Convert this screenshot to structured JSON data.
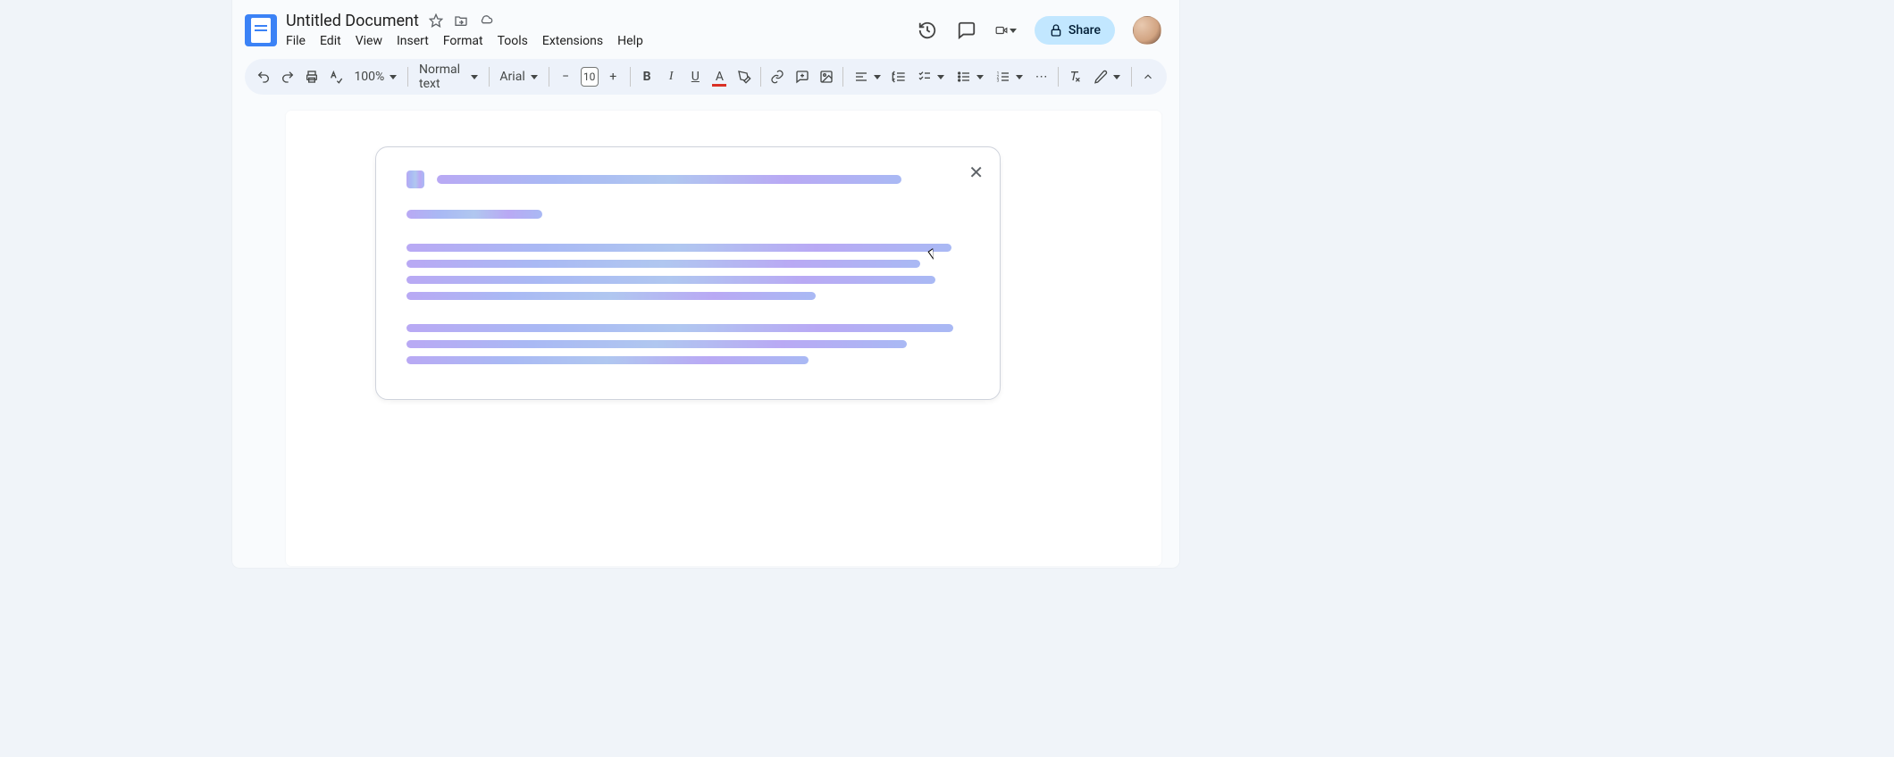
{
  "header": {
    "doc_title": "Untitled Document",
    "menus": {
      "file": "File",
      "edit": "Edit",
      "view": "View",
      "insert": "Insert",
      "format": "Format",
      "tools": "Tools",
      "extensions": "Extensions",
      "help": "Help"
    },
    "share_label": "Share"
  },
  "toolbar": {
    "zoom": "100%",
    "style": "Normal text",
    "font": "Arial",
    "font_size": "10",
    "bold": "B",
    "italic": "I",
    "underline": "U",
    "text_color_letter": "A",
    "more": "⋯"
  },
  "icons": {
    "star": "star-icon",
    "move": "move-to-folder-icon",
    "cloud": "cloud-saved-icon",
    "history": "version-history-icon",
    "comment": "comment-icon",
    "meet": "meet-icon",
    "lock": "lock-icon",
    "undo": "undo-icon",
    "redo": "redo-icon",
    "print": "print-icon",
    "spell": "spellcheck-icon",
    "minus": "decrease-font-icon",
    "plus": "increase-font-icon",
    "highlight": "highlight-icon",
    "link": "insert-link-icon",
    "image": "insert-image-icon",
    "insert": "insert-icon",
    "align": "align-icon",
    "line_spacing": "line-spacing-icon",
    "checklist": "checklist-icon",
    "bullets": "bulleted-list-icon",
    "numbers": "numbered-list-icon",
    "clear_format": "clear-formatting-icon",
    "editing": "editing-mode-icon",
    "collapse": "hide-menus-icon",
    "close": "close-icon"
  }
}
